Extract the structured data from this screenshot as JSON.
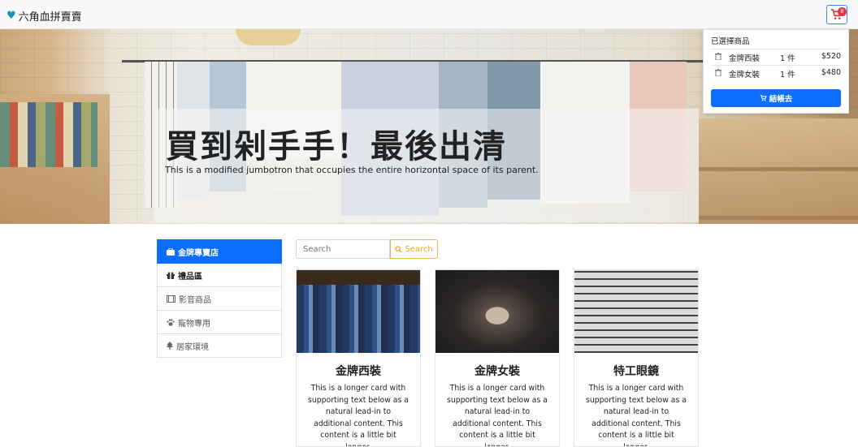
{
  "navbar": {
    "brand": "六角血拼賣賣",
    "cart_count": "8"
  },
  "hero": {
    "title": "買到剁手手！最後出清",
    "lead": "This is a modified jumbotron that occupies the entire horizontal space of its parent."
  },
  "cart": {
    "header": "已選擇商品",
    "items": [
      {
        "name": "金牌西裝",
        "qty": "1 件",
        "price": "$520"
      },
      {
        "name": "金牌女裝",
        "qty": "1 件",
        "price": "$480"
      }
    ],
    "checkout_label": "結帳去"
  },
  "sidebar": {
    "items": [
      {
        "label": "金牌專賣店",
        "icon": "briefcase-icon"
      },
      {
        "label": "禮品區",
        "icon": "gift-icon"
      },
      {
        "label": "影音商品",
        "icon": "film-icon"
      },
      {
        "label": "寵物專用",
        "icon": "paw-icon"
      },
      {
        "label": "居家環境",
        "icon": "tree-icon"
      }
    ]
  },
  "search": {
    "placeholder": "Search",
    "button_label": "Search"
  },
  "products": [
    {
      "title": "金牌西裝",
      "text": "This is a longer card with supporting text below as a natural lead-in to additional content. This content is a little bit longer."
    },
    {
      "title": "金牌女裝",
      "text": "This is a longer card with supporting text below as a natural lead-in to additional content. This content is a little bit longer."
    },
    {
      "title": "特工眼鏡",
      "text": "This is a longer card with supporting text below as a natural lead-in to additional content. This content is a little bit longer."
    }
  ],
  "colors": {
    "primary": "#0d6efd",
    "warning": "#f0a61e",
    "danger": "#dc3545"
  }
}
